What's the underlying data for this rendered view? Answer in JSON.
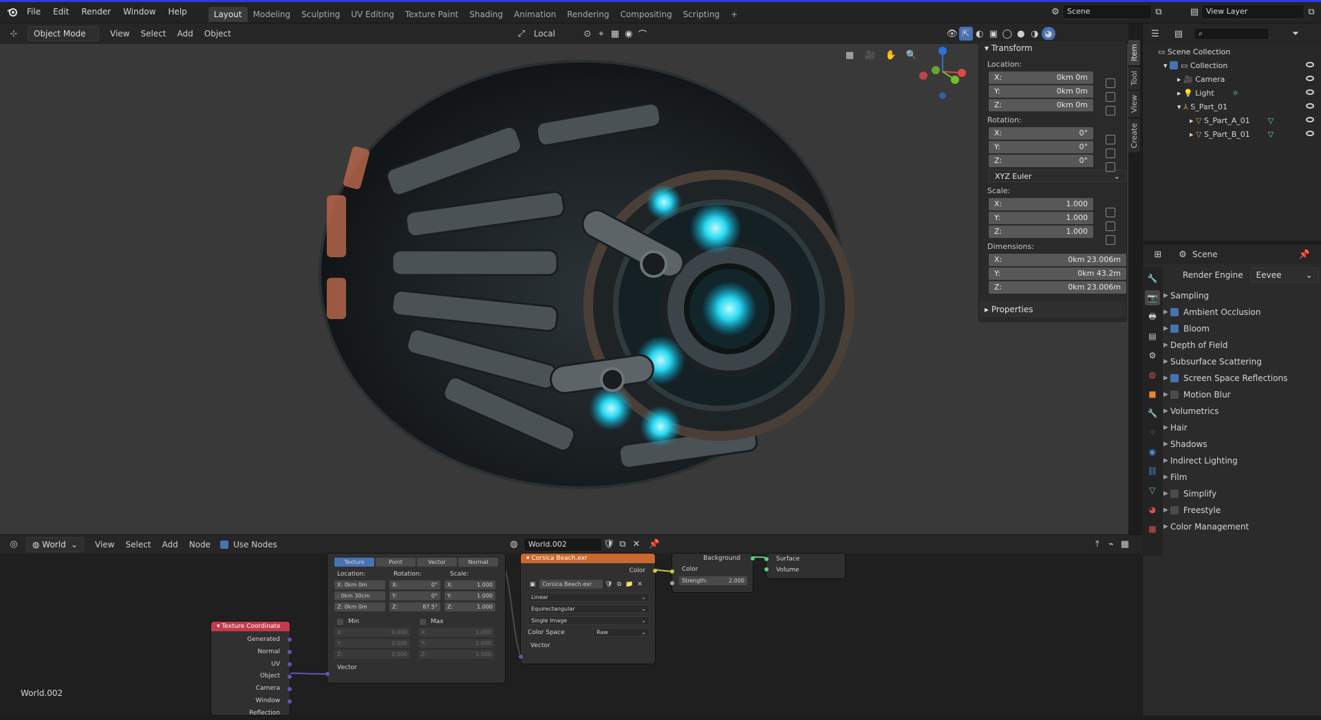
{
  "topbar": {
    "menus": [
      "File",
      "Edit",
      "Render",
      "Window",
      "Help"
    ],
    "workspaces": [
      "Layout",
      "Modeling",
      "Sculpting",
      "UV Editing",
      "Texture Paint",
      "Shading",
      "Animation",
      "Rendering",
      "Compositing",
      "Scripting"
    ],
    "active_workspace": "Layout",
    "add_tab": "+",
    "scene_name": "Scene",
    "view_layer": "View Layer"
  },
  "viewport_header": {
    "mode": "Object Mode",
    "menus": [
      "View",
      "Select",
      "Add",
      "Object"
    ],
    "transform_orientation": "Local"
  },
  "npanel": {
    "tabs": [
      "Item",
      "Tool",
      "View",
      "Create"
    ],
    "transform_title": "Transform",
    "location_label": "Location:",
    "location": [
      {
        "axis": "X:",
        "value": "0km 0m"
      },
      {
        "axis": "Y:",
        "value": "0km 0m"
      },
      {
        "axis": "Z:",
        "value": "0km 0m"
      }
    ],
    "rotation_label": "Rotation:",
    "rotation": [
      {
        "axis": "X:",
        "value": "0°"
      },
      {
        "axis": "Y:",
        "value": "0°"
      },
      {
        "axis": "Z:",
        "value": "0°"
      }
    ],
    "rotation_mode": "XYZ Euler",
    "scale_label": "Scale:",
    "scale": [
      {
        "axis": "X:",
        "value": "1.000"
      },
      {
        "axis": "Y:",
        "value": "1.000"
      },
      {
        "axis": "Z:",
        "value": "1.000"
      }
    ],
    "dimensions_label": "Dimensions:",
    "dimensions": [
      {
        "axis": "X:",
        "value": "0km 23.006m"
      },
      {
        "axis": "Y:",
        "value": "0km 43.2m"
      },
      {
        "axis": "Z:",
        "value": "0km 23.006m"
      }
    ],
    "properties_title": "Properties"
  },
  "outliner": {
    "root": "Scene Collection",
    "items": [
      {
        "name": "Collection",
        "level": 1
      },
      {
        "name": "Camera",
        "level": 2
      },
      {
        "name": "Light",
        "level": 2
      },
      {
        "name": "S_Part_01",
        "level": 2
      },
      {
        "name": "S_Part_A_01",
        "level": 3
      },
      {
        "name": "S_Part_B_01",
        "level": 3
      }
    ]
  },
  "properties": {
    "context": "Scene",
    "render_engine_label": "Render Engine",
    "render_engine": "Eevee",
    "panels": [
      {
        "label": "Sampling",
        "checkbox": null
      },
      {
        "label": "Ambient Occlusion",
        "checkbox": true
      },
      {
        "label": "Bloom",
        "checkbox": true
      },
      {
        "label": "Depth of Field",
        "checkbox": null
      },
      {
        "label": "Subsurface Scattering",
        "checkbox": null
      },
      {
        "label": "Screen Space Reflections",
        "checkbox": true
      },
      {
        "label": "Motion Blur",
        "checkbox": false
      },
      {
        "label": "Volumetrics",
        "checkbox": null
      },
      {
        "label": "Hair",
        "checkbox": null
      },
      {
        "label": "Shadows",
        "checkbox": null
      },
      {
        "label": "Indirect Lighting",
        "checkbox": null
      },
      {
        "label": "Film",
        "checkbox": null
      },
      {
        "label": "Simplify",
        "checkbox": false
      },
      {
        "label": "Freestyle",
        "checkbox": false
      },
      {
        "label": "Color Management",
        "checkbox": null
      }
    ]
  },
  "node_editor": {
    "type": "World",
    "menus": [
      "View",
      "Select",
      "Add",
      "Node"
    ],
    "use_nodes_label": "Use Nodes",
    "world_name": "World.002",
    "corner_label": "World.002",
    "texcoord": {
      "title": "Texture Coordinate",
      "outputs": [
        "Generated",
        "Normal",
        "UV",
        "Object",
        "Camera",
        "Window",
        "Reflection"
      ]
    },
    "mapping": {
      "tabs": [
        "Texture",
        "Point",
        "Vector",
        "Normal"
      ],
      "location_label": "Location:",
      "rotation_label": "Rotation:",
      "scale_label": "Scale:",
      "loc": [
        "X:   0km 0m",
        ":   0km 30cm",
        "Z:   0km 0m"
      ],
      "rot": [
        "X:",
        "Y:",
        "Z:"
      ],
      "rot_vals": [
        "0°",
        "0°",
        "87.5°"
      ],
      "scl": [
        "X:",
        "Y:",
        "Z:"
      ],
      "scl_vals": [
        "1.000",
        "1.000",
        "1.000"
      ],
      "min_label": "Min",
      "max_label": "Max",
      "min": [
        "X:",
        "Y:",
        "Z:"
      ],
      "min_vals": [
        "0.000",
        "0.000",
        "0.000"
      ],
      "max": [
        "X:",
        "Y:",
        "Z:"
      ],
      "max_vals": [
        "1.000",
        "1.000",
        "1.000"
      ],
      "vector_label": "Vector"
    },
    "envtex": {
      "title": "Corsica Beach.exr",
      "color_out": "Color",
      "image": "Corsica Beach.exr",
      "interpolation": "Linear",
      "projection": "Equirectangular",
      "source": "Single Image",
      "colorspace_label": "Color Space",
      "colorspace": "Raw",
      "vector_label": "Vector"
    },
    "background": {
      "title": "Background",
      "color": "Color",
      "strength_label": "Strength:",
      "strength": "2.000"
    },
    "output": {
      "surface": "Surface",
      "volume": "Volume"
    }
  }
}
